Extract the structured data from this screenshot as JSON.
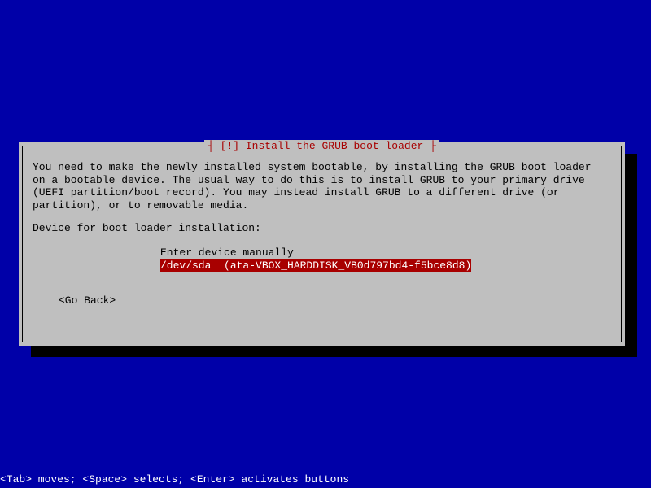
{
  "dialog": {
    "title": "┤ [!] Install the GRUB boot loader ├",
    "description": "You need to make the newly installed system bootable, by installing the GRUB boot loader\non a bootable device. The usual way to do this is to install GRUB to your primary drive\n(UEFI partition/boot record). You may instead install GRUB to a different drive (or\npartition), or to removable media.",
    "prompt": "Device for boot loader installation:",
    "options": [
      {
        "label": "Enter device manually",
        "selected": false
      },
      {
        "label": "/dev/sda  (ata-VBOX_HARDDISK_VB0d797bd4-f5bce8d8)",
        "selected": true
      }
    ],
    "go_back": "<Go Back>"
  },
  "status_bar": "<Tab> moves; <Space> selects; <Enter> activates buttons"
}
